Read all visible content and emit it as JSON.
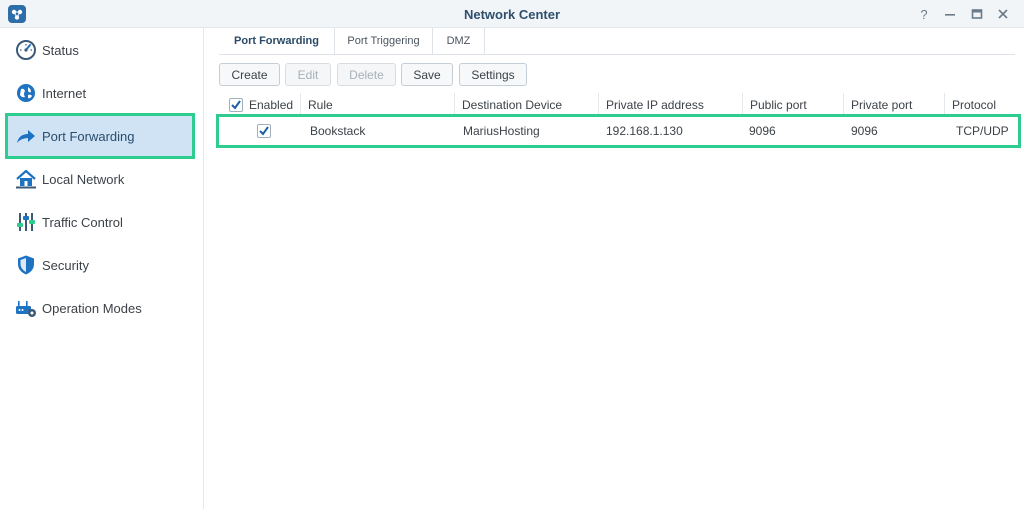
{
  "window": {
    "title": "Network Center"
  },
  "sidebar": {
    "items": [
      {
        "label": "Status",
        "icon": "status-gauge-icon"
      },
      {
        "label": "Internet",
        "icon": "globe-icon"
      },
      {
        "label": "Port Forwarding",
        "icon": "forward-arrow-icon",
        "active": true
      },
      {
        "label": "Local Network",
        "icon": "house-icon"
      },
      {
        "label": "Traffic Control",
        "icon": "sliders-icon"
      },
      {
        "label": "Security",
        "icon": "shield-icon"
      },
      {
        "label": "Operation Modes",
        "icon": "router-gear-icon"
      }
    ]
  },
  "tabs": [
    {
      "label": "Port Forwarding",
      "active": true
    },
    {
      "label": "Port Triggering"
    },
    {
      "label": "DMZ"
    }
  ],
  "toolbar": {
    "create": "Create",
    "edit": "Edit",
    "delete": "Delete",
    "save": "Save",
    "settings": "Settings"
  },
  "grid": {
    "columns": [
      "Enabled",
      "Rule",
      "Destination Device",
      "Private IP address",
      "Public port",
      "Private port",
      "Protocol"
    ],
    "rows": [
      {
        "enabled": true,
        "rule": "Bookstack",
        "device": "MariusHosting",
        "private_ip": "192.168.1.130",
        "public_port": "9096",
        "private_port": "9096",
        "protocol": "TCP/UDP"
      }
    ]
  },
  "colors": {
    "accent": "#2ecc8e",
    "selected_nav": "#cfe3f5",
    "brand": "#1d72c2"
  }
}
